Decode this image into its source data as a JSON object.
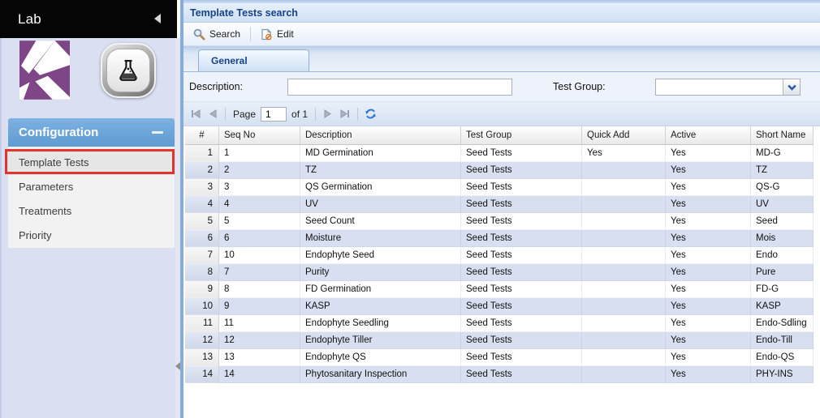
{
  "colors": {
    "accent": "#15428b",
    "sidebar_bg": "#dadff2",
    "section_blue_top": "#7db1e1",
    "section_blue_bottom": "#5f9bd2",
    "menu_bg": "#f2f2f2",
    "selected_item_bg": "#e6e6e6",
    "annotation_red": "#de352c",
    "alt_row_blue": "#d7dff0",
    "logo_purple": "#7e4687",
    "header_black": "#050505"
  },
  "sidebar": {
    "title": "Lab",
    "icons": {
      "collapse": "left-triangle",
      "company_logo": "purple-ribbon-mark",
      "lab_badge": "erlenmeyer-flask"
    },
    "section": {
      "title": "Configuration",
      "collapse_glyph": "minus"
    },
    "items": [
      {
        "label": "Template Tests",
        "selected": true,
        "annotated": true
      },
      {
        "label": "Parameters",
        "selected": false
      },
      {
        "label": "Treatments",
        "selected": false
      },
      {
        "label": "Priority",
        "selected": false
      }
    ]
  },
  "main": {
    "panel_title": "Template Tests search",
    "toolbar": {
      "search_label": "Search",
      "edit_label": "Edit",
      "icons": {
        "search": "magnifier",
        "edit": "page-with-pencil"
      }
    },
    "tabs": [
      {
        "label": "General",
        "active": true
      }
    ],
    "filters": {
      "description_label": "Description:",
      "description_value": "",
      "test_group_label": "Test Group:",
      "test_group_value": ""
    },
    "pager": {
      "page_label": "Page",
      "page_value": "1",
      "of_label": "of 1",
      "icons": [
        "first-page",
        "prev-page",
        "next-page",
        "last-page",
        "refresh"
      ]
    },
    "grid": {
      "columns": [
        "#",
        "Seq No",
        "Description",
        "Test Group",
        "Quick Add",
        "Active",
        "Short Name"
      ],
      "rows": [
        [
          "1",
          "1",
          "MD Germination",
          "Seed Tests",
          "Yes",
          "Yes",
          "MD-G"
        ],
        [
          "2",
          "2",
          "TZ",
          "Seed Tests",
          "",
          "Yes",
          "TZ"
        ],
        [
          "3",
          "3",
          "QS Germination",
          "Seed Tests",
          "",
          "Yes",
          "QS-G"
        ],
        [
          "4",
          "4",
          "UV",
          "Seed Tests",
          "",
          "Yes",
          "UV"
        ],
        [
          "5",
          "5",
          "Seed Count",
          "Seed Tests",
          "",
          "Yes",
          "Seed"
        ],
        [
          "6",
          "6",
          "Moisture",
          "Seed Tests",
          "",
          "Yes",
          "Mois"
        ],
        [
          "7",
          "10",
          "Endophyte Seed",
          "Seed Tests",
          "",
          "Yes",
          "Endo"
        ],
        [
          "8",
          "7",
          "Purity",
          "Seed Tests",
          "",
          "Yes",
          "Pure"
        ],
        [
          "9",
          "8",
          "FD Germination",
          "Seed Tests",
          "",
          "Yes",
          "FD-G"
        ],
        [
          "10",
          "9",
          "KASP",
          "Seed Tests",
          "",
          "Yes",
          "KASP"
        ],
        [
          "11",
          "11",
          "Endophyte Seedling",
          "Seed Tests",
          "",
          "Yes",
          "Endo-Sdling"
        ],
        [
          "12",
          "12",
          "Endophyte Tiller",
          "Seed Tests",
          "",
          "Yes",
          "Endo-Till"
        ],
        [
          "13",
          "13",
          "Endophyte QS",
          "Seed Tests",
          "",
          "Yes",
          "Endo-QS"
        ],
        [
          "14",
          "14",
          "Phytosanitary Inspection",
          "Seed Tests",
          "",
          "Yes",
          "PHY-INS"
        ]
      ]
    }
  }
}
